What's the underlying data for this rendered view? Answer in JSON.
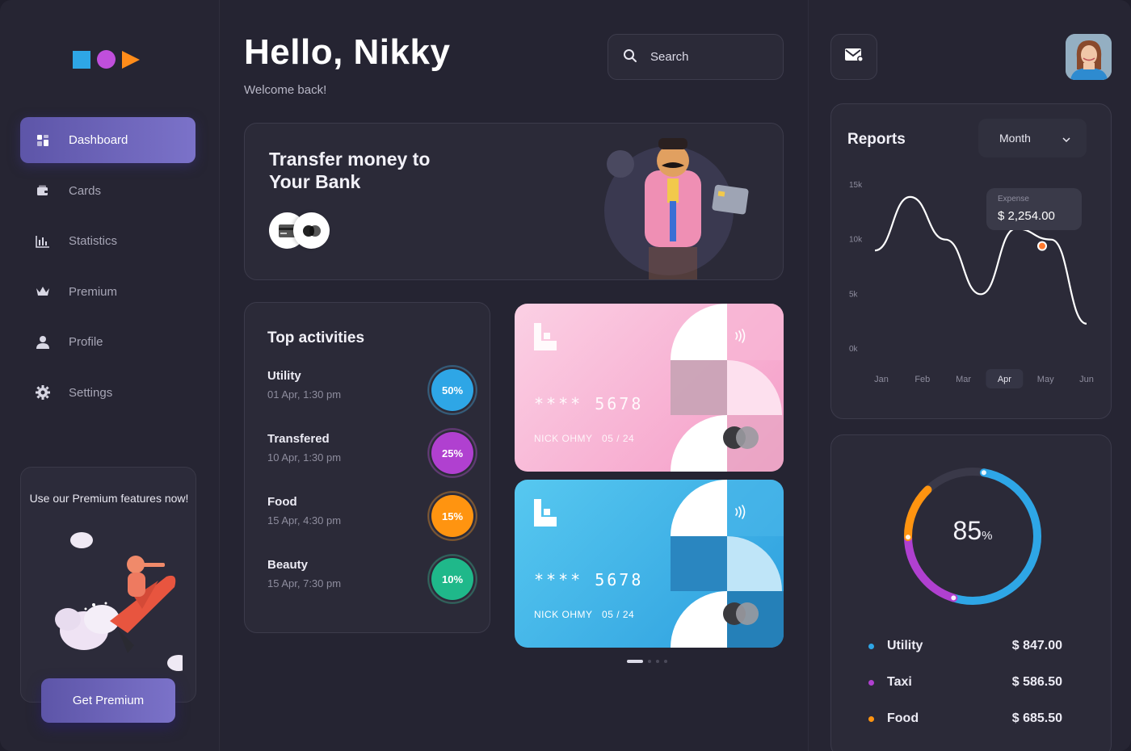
{
  "header": {
    "greeting": "Hello, Nikky",
    "welcome": "Welcome back!"
  },
  "search": {
    "placeholder": "Search",
    "icon": "search-icon"
  },
  "sidebar": {
    "items": [
      {
        "label": "Dashboard",
        "icon": "grid-icon",
        "active": true
      },
      {
        "label": "Cards",
        "icon": "wallet-icon",
        "active": false
      },
      {
        "label": "Statistics",
        "icon": "bar-chart-icon",
        "active": false
      },
      {
        "label": "Premium",
        "icon": "crown-icon",
        "active": false
      },
      {
        "label": "Profile",
        "icon": "user-icon",
        "active": false
      },
      {
        "label": "Settings",
        "icon": "gear-icon",
        "active": false
      }
    ],
    "promo": {
      "text": "Use our Premium features now!",
      "button": "Get Premium"
    }
  },
  "transfer": {
    "title": "Transfer money to Your Bank"
  },
  "activities": {
    "title": "Top activities",
    "items": [
      {
        "name": "Utility",
        "date": "01 Apr, 1:30 pm",
        "percent": "50%",
        "color": "#2ea6e6"
      },
      {
        "name": "Transfered",
        "date": "10 Apr, 1:30 pm",
        "percent": "25%",
        "color": "#b040d0"
      },
      {
        "name": "Food",
        "date": "15 Apr, 4:30 pm",
        "percent": "15%",
        "color": "#ff9410"
      },
      {
        "name": "Beauty",
        "date": "15 Apr, 7:30 pm",
        "percent": "10%",
        "color": "#1fb88a"
      }
    ]
  },
  "cards": [
    {
      "number": "**** 5678",
      "holder": "NICK OHMY",
      "expiry": "05 / 24",
      "theme": "pink"
    },
    {
      "number": "**** 5678",
      "holder": "NICK OHMY",
      "expiry": "05 / 24",
      "theme": "blue"
    }
  ],
  "reports": {
    "title": "Reports",
    "period": "Month",
    "tooltip_label": "Expense",
    "tooltip_value": "$ 2,254.00"
  },
  "chart_data": {
    "type": "line",
    "title": "",
    "x": [
      "Jan",
      "Feb",
      "Mar",
      "Apr",
      "May",
      "Jun"
    ],
    "y_ticks": [
      "15k",
      "10k",
      "5k",
      "0k"
    ],
    "ylim": [
      0,
      15000
    ],
    "highlighted": "Apr",
    "series": [
      {
        "values": [
          9000,
          13900,
          10000,
          5000,
          11000,
          10000,
          2300
        ]
      }
    ],
    "accent": "#ff7a2f"
  },
  "spending": {
    "percent": "85",
    "percent_unit": "%",
    "segments": [
      {
        "name": "Utility",
        "amount": "$ 847.00",
        "color": "#2ea6e6",
        "share": 0.52
      },
      {
        "name": "Taxi",
        "amount": "$ 586.50",
        "color": "#b040d0",
        "share": 0.2
      },
      {
        "name": "Food",
        "amount": "$ 685.50",
        "color": "#ff9410",
        "share": 0.13
      }
    ]
  }
}
